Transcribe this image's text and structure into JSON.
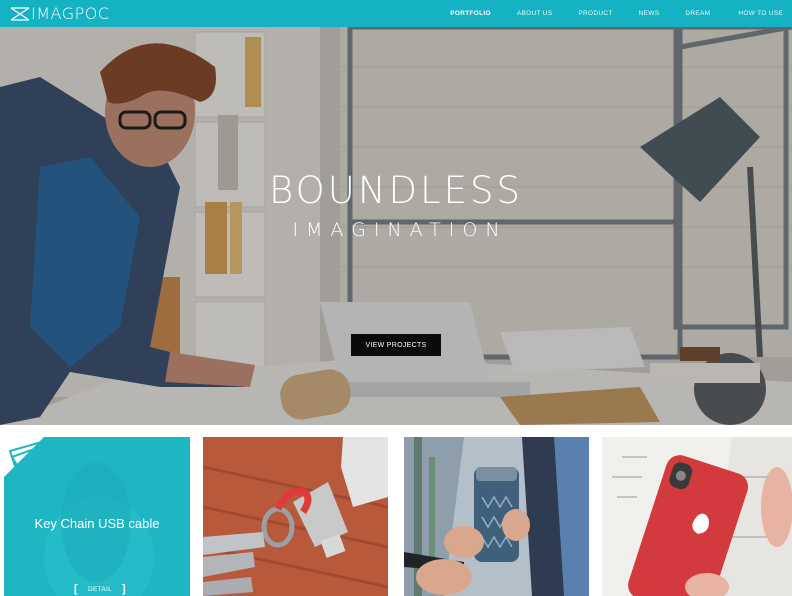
{
  "brand": {
    "name": "IMAGPOC",
    "color": "#14b2c2"
  },
  "nav": {
    "items": [
      {
        "label": "PORTFOLIO",
        "active": true
      },
      {
        "label": "ABOUT US",
        "active": false
      },
      {
        "label": "PRODUCT",
        "active": false
      },
      {
        "label": "NEWS",
        "active": false
      },
      {
        "label": "DREAM",
        "active": false
      },
      {
        "label": "HOW TO USE",
        "active": false
      }
    ]
  },
  "hero": {
    "title": "BOUNDLESS",
    "subtitle": "IMAGINATION",
    "button": "VIEW PROJECTS"
  },
  "tiles": [
    {
      "title": "Key Chain USB cable",
      "detail": "DETAIL"
    }
  ]
}
